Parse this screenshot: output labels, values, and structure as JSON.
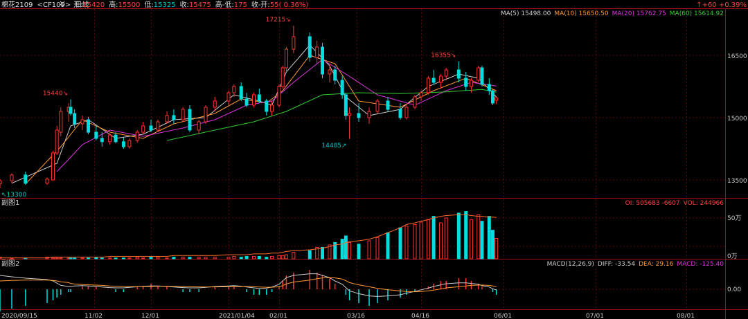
{
  "header": {
    "symbol": "棉花2109",
    "code": "<CF109>",
    "period": "日线",
    "period_icon": "double-chevron-down-icon",
    "items": [
      {
        "label": "开:",
        "value": "15420",
        "color": "#ff4040"
      },
      {
        "label": "高:",
        "value": "15500",
        "color": "#ff4040"
      },
      {
        "label": "低:",
        "value": "15325",
        "color": "#00cccc"
      },
      {
        "label": "收:",
        "value": "15475",
        "color": "#ff4040"
      },
      {
        "label": "高-低:",
        "value": "175",
        "color": "#ff4040"
      },
      {
        "label": "收-开:",
        "value": "55( 0.36%)",
        "color": "#ff4040"
      }
    ],
    "change": "↑+60  +0.39%"
  },
  "ma_legend": [
    {
      "label": "MA(5)",
      "value": "15498.00",
      "color": "#cccccc"
    },
    {
      "label": "MA(10)",
      "value": "15650.50",
      "color": "#ff9933"
    },
    {
      "label": "MA(20)",
      "value": "15762.75",
      "color": "#dd33dd"
    },
    {
      "label": "MA(60)",
      "value": "15614.92",
      "color": "#33cc33"
    }
  ],
  "sub1": {
    "title": "副图1",
    "legend": [
      {
        "label": "OI:",
        "value": "505683 -6607",
        "color": "#ff4040"
      },
      {
        "label": "VOL:",
        "value": "244966",
        "color": "#ff4040"
      }
    ],
    "axis": [
      "50万",
      "0万"
    ]
  },
  "sub2": {
    "title": "副图2",
    "legend": [
      {
        "label": "MACD(12,26,9)",
        "value": "",
        "color": "#cccccc"
      },
      {
        "label": "DIFF:",
        "value": "-33.54",
        "color": "#cccccc"
      },
      {
        "label": "DEA:",
        "value": "29.16",
        "color": "#ff9933"
      },
      {
        "label": "MACD:",
        "value": "-125.40",
        "color": "#dd33dd"
      }
    ],
    "axis": [
      "0.00"
    ]
  },
  "annotations": [
    {
      "text": "17215↘",
      "date": "2021-02-09",
      "price": 17215,
      "color": "#ff4040"
    },
    {
      "text": "15440↘",
      "date": "2020-10-21",
      "price": 15440,
      "color": "#ff4040"
    },
    {
      "text": "16355↘",
      "date": "2021-05-07",
      "price": 16355,
      "color": "#ff4040"
    },
    {
      "text": "14485↗",
      "date": "2021-03-12",
      "price": 14485,
      "color": "#00cccc"
    },
    {
      "text": "↖13300",
      "date": "2020-09-15",
      "price": 13300,
      "color": "#00cccc"
    }
  ],
  "chart_data": {
    "type": "candlestick",
    "price_ticks": [
      13500,
      15000,
      16500
    ],
    "price_range": [
      13250,
      17450
    ],
    "x_tick_labels": [
      "2020/09/15",
      "11/02",
      "12/01",
      "2021/01/04",
      "02/01",
      "03/16",
      "04/16",
      "06/01",
      "07/01",
      "08/01"
    ],
    "candles": [
      {
        "d": "2020-09-15",
        "o": 13410,
        "h": 13520,
        "l": 13300,
        "c": 13480
      },
      {
        "d": "2020-09-21",
        "o": 13480,
        "h": 13660,
        "l": 13420,
        "c": 13620
      },
      {
        "d": "2020-09-28",
        "o": 13620,
        "h": 13700,
        "l": 13380,
        "c": 13420
      },
      {
        "d": "2020-10-09",
        "o": 13420,
        "h": 13560,
        "l": 13380,
        "c": 13520
      },
      {
        "d": "2020-10-12",
        "o": 13500,
        "h": 14200,
        "l": 13480,
        "c": 14150
      },
      {
        "d": "2020-10-14",
        "o": 14150,
        "h": 14800,
        "l": 14100,
        "c": 14700
      },
      {
        "d": "2020-10-16",
        "o": 14650,
        "h": 15250,
        "l": 14550,
        "c": 15150
      },
      {
        "d": "2020-10-20",
        "o": 15150,
        "h": 15350,
        "l": 14900,
        "c": 15250
      },
      {
        "d": "2020-10-21",
        "o": 15250,
        "h": 15440,
        "l": 15050,
        "c": 15100
      },
      {
        "d": "2020-10-23",
        "o": 15100,
        "h": 15200,
        "l": 14750,
        "c": 14850
      },
      {
        "d": "2020-10-27",
        "o": 14850,
        "h": 15050,
        "l": 14700,
        "c": 14950
      },
      {
        "d": "2020-10-30",
        "o": 14950,
        "h": 15020,
        "l": 14600,
        "c": 14650
      },
      {
        "d": "2020-11-03",
        "o": 14650,
        "h": 14800,
        "l": 14450,
        "c": 14500
      },
      {
        "d": "2020-11-06",
        "o": 14500,
        "h": 14650,
        "l": 14300,
        "c": 14420
      },
      {
        "d": "2020-11-10",
        "o": 14420,
        "h": 14620,
        "l": 14350,
        "c": 14580
      },
      {
        "d": "2020-11-13",
        "o": 14580,
        "h": 14650,
        "l": 14380,
        "c": 14420
      },
      {
        "d": "2020-11-17",
        "o": 14420,
        "h": 14520,
        "l": 14250,
        "c": 14300
      },
      {
        "d": "2020-11-20",
        "o": 14300,
        "h": 14500,
        "l": 14250,
        "c": 14450
      },
      {
        "d": "2020-11-24",
        "o": 14450,
        "h": 14700,
        "l": 14400,
        "c": 14650
      },
      {
        "d": "2020-11-27",
        "o": 14650,
        "h": 14900,
        "l": 14600,
        "c": 14800
      },
      {
        "d": "2020-12-01",
        "o": 14800,
        "h": 14950,
        "l": 14650,
        "c": 14700
      },
      {
        "d": "2020-12-04",
        "o": 14700,
        "h": 14950,
        "l": 14650,
        "c": 14900
      },
      {
        "d": "2020-12-08",
        "o": 14900,
        "h": 15150,
        "l": 14850,
        "c": 15050
      },
      {
        "d": "2020-12-11",
        "o": 15050,
        "h": 15200,
        "l": 14850,
        "c": 14950
      },
      {
        "d": "2020-12-15",
        "o": 14950,
        "h": 15250,
        "l": 14900,
        "c": 15200
      },
      {
        "d": "2020-12-18",
        "o": 15200,
        "h": 15300,
        "l": 14650,
        "c": 14700
      },
      {
        "d": "2020-12-22",
        "o": 14700,
        "h": 14950,
        "l": 14600,
        "c": 14900
      },
      {
        "d": "2020-12-25",
        "o": 14900,
        "h": 15300,
        "l": 14850,
        "c": 15250
      },
      {
        "d": "2020-12-29",
        "o": 15250,
        "h": 15500,
        "l": 15150,
        "c": 15400
      },
      {
        "d": "2021-01-04",
        "o": 15400,
        "h": 15650,
        "l": 15300,
        "c": 15600
      },
      {
        "d": "2021-01-07",
        "o": 15600,
        "h": 15800,
        "l": 15500,
        "c": 15750
      },
      {
        "d": "2021-01-11",
        "o": 15750,
        "h": 15850,
        "l": 15400,
        "c": 15450
      },
      {
        "d": "2021-01-14",
        "o": 15450,
        "h": 15600,
        "l": 15250,
        "c": 15300
      },
      {
        "d": "2021-01-18",
        "o": 15300,
        "h": 15600,
        "l": 15250,
        "c": 15550
      },
      {
        "d": "2021-01-21",
        "o": 15550,
        "h": 15700,
        "l": 15350,
        "c": 15400
      },
      {
        "d": "2021-01-25",
        "o": 15400,
        "h": 15450,
        "l": 15050,
        "c": 15150
      },
      {
        "d": "2021-01-28",
        "o": 15150,
        "h": 15400,
        "l": 15050,
        "c": 15300
      },
      {
        "d": "2021-02-01",
        "o": 15300,
        "h": 15800,
        "l": 15250,
        "c": 15750
      },
      {
        "d": "2021-02-03",
        "o": 15750,
        "h": 16250,
        "l": 15700,
        "c": 16200
      },
      {
        "d": "2021-02-05",
        "o": 16200,
        "h": 16700,
        "l": 16100,
        "c": 16650
      },
      {
        "d": "2021-02-09",
        "o": 16650,
        "h": 17215,
        "l": 16550,
        "c": 16950
      },
      {
        "d": "2021-02-18",
        "o": 16950,
        "h": 17050,
        "l": 16350,
        "c": 16450
      },
      {
        "d": "2021-02-22",
        "o": 16450,
        "h": 16850,
        "l": 16300,
        "c": 16700
      },
      {
        "d": "2021-02-25",
        "o": 16700,
        "h": 16800,
        "l": 15950,
        "c": 16050
      },
      {
        "d": "2021-03-01",
        "o": 16050,
        "h": 16300,
        "l": 15850,
        "c": 16150
      },
      {
        "d": "2021-03-04",
        "o": 16150,
        "h": 16250,
        "l": 15800,
        "c": 15900
      },
      {
        "d": "2021-03-08",
        "o": 15900,
        "h": 16000,
        "l": 15450,
        "c": 15550
      },
      {
        "d": "2021-03-10",
        "o": 15550,
        "h": 15600,
        "l": 14950,
        "c": 15050
      },
      {
        "d": "2021-03-12",
        "o": 15050,
        "h": 15250,
        "l": 14485,
        "c": 15100
      },
      {
        "d": "2021-03-17",
        "o": 15100,
        "h": 15350,
        "l": 14900,
        "c": 15000
      },
      {
        "d": "2021-03-22",
        "o": 15000,
        "h": 15250,
        "l": 14850,
        "c": 15150
      },
      {
        "d": "2021-03-26",
        "o": 15150,
        "h": 15450,
        "l": 15100,
        "c": 15400
      },
      {
        "d": "2021-03-31",
        "o": 15400,
        "h": 15500,
        "l": 15150,
        "c": 15200
      },
      {
        "d": "2021-04-06",
        "o": 15200,
        "h": 15350,
        "l": 14950,
        "c": 15000
      },
      {
        "d": "2021-04-09",
        "o": 15000,
        "h": 15300,
        "l": 14950,
        "c": 15250
      },
      {
        "d": "2021-04-13",
        "o": 15250,
        "h": 15550,
        "l": 15200,
        "c": 15500
      },
      {
        "d": "2021-04-16",
        "o": 15500,
        "h": 15650,
        "l": 15400,
        "c": 15600
      },
      {
        "d": "2021-04-20",
        "o": 15600,
        "h": 16000,
        "l": 15550,
        "c": 15950
      },
      {
        "d": "2021-04-23",
        "o": 15950,
        "h": 16150,
        "l": 15800,
        "c": 15850
      },
      {
        "d": "2021-04-27",
        "o": 15850,
        "h": 16050,
        "l": 15700,
        "c": 16000
      },
      {
        "d": "2021-04-30",
        "o": 16000,
        "h": 16200,
        "l": 15900,
        "c": 16150
      },
      {
        "d": "2021-05-07",
        "o": 16150,
        "h": 16355,
        "l": 15850,
        "c": 15950
      },
      {
        "d": "2021-05-11",
        "o": 15950,
        "h": 16100,
        "l": 15650,
        "c": 15750
      },
      {
        "d": "2021-05-14",
        "o": 15750,
        "h": 15950,
        "l": 15600,
        "c": 15900
      },
      {
        "d": "2021-05-18",
        "o": 15900,
        "h": 16250,
        "l": 15850,
        "c": 16200
      },
      {
        "d": "2021-05-20",
        "o": 16200,
        "h": 16250,
        "l": 15750,
        "c": 15800
      },
      {
        "d": "2021-05-24",
        "o": 15800,
        "h": 15950,
        "l": 15550,
        "c": 15650
      },
      {
        "d": "2021-05-26",
        "o": 15650,
        "h": 15700,
        "l": 15300,
        "c": 15350
      },
      {
        "d": "2021-05-28",
        "o": 15420,
        "h": 15500,
        "l": 15325,
        "c": 15475
      }
    ],
    "ma_lines": [
      {
        "name": "MA(5)",
        "color": "#cccccc",
        "points": [
          [
            "2020-09-21",
            13420
          ],
          [
            "2020-10-14",
            13900
          ],
          [
            "2020-10-21",
            14800
          ],
          [
            "2020-10-30",
            14950
          ],
          [
            "2020-11-13",
            14500
          ],
          [
            "2020-11-27",
            14600
          ],
          [
            "2020-12-11",
            14950
          ],
          [
            "2020-12-25",
            15000
          ],
          [
            "2021-01-07",
            15550
          ],
          [
            "2021-01-21",
            15400
          ],
          [
            "2021-01-28",
            15300
          ],
          [
            "2021-02-05",
            16100
          ],
          [
            "2021-02-18",
            16750
          ],
          [
            "2021-03-01",
            16250
          ],
          [
            "2021-03-10",
            15500
          ],
          [
            "2021-03-22",
            15050
          ],
          [
            "2021-04-06",
            15200
          ],
          [
            "2021-04-20",
            15750
          ],
          [
            "2021-05-07",
            16050
          ],
          [
            "2021-05-18",
            15950
          ],
          [
            "2021-05-28",
            15500
          ]
        ]
      },
      {
        "name": "MA(10)",
        "color": "#ff9933",
        "points": [
          [
            "2020-09-28",
            13400
          ],
          [
            "2020-10-16",
            14300
          ],
          [
            "2020-10-27",
            14950
          ],
          [
            "2020-11-10",
            14650
          ],
          [
            "2020-11-27",
            14500
          ],
          [
            "2020-12-11",
            14850
          ],
          [
            "2020-12-29",
            15100
          ],
          [
            "2021-01-11",
            15450
          ],
          [
            "2021-01-25",
            15350
          ],
          [
            "2021-02-03",
            15650
          ],
          [
            "2021-02-18",
            16500
          ],
          [
            "2021-03-04",
            16300
          ],
          [
            "2021-03-17",
            15400
          ],
          [
            "2021-04-06",
            15250
          ],
          [
            "2021-04-23",
            15650
          ],
          [
            "2021-05-11",
            15950
          ],
          [
            "2021-05-28",
            15650
          ]
        ]
      },
      {
        "name": "MA(20)",
        "color": "#dd33dd",
        "points": [
          [
            "2020-10-14",
            13700
          ],
          [
            "2020-10-27",
            14350
          ],
          [
            "2020-11-10",
            14700
          ],
          [
            "2020-11-27",
            14550
          ],
          [
            "2020-12-15",
            14750
          ],
          [
            "2020-12-29",
            14950
          ],
          [
            "2021-01-14",
            15300
          ],
          [
            "2021-01-28",
            15400
          ],
          [
            "2021-02-09",
            15850
          ],
          [
            "2021-02-25",
            16400
          ],
          [
            "2021-03-10",
            16050
          ],
          [
            "2021-03-26",
            15550
          ],
          [
            "2021-04-13",
            15300
          ],
          [
            "2021-04-30",
            15650
          ],
          [
            "2021-05-14",
            15850
          ],
          [
            "2021-05-28",
            15763
          ]
        ]
      },
      {
        "name": "MA(60)",
        "color": "#33cc33",
        "points": [
          [
            "2020-12-08",
            14450
          ],
          [
            "2020-12-29",
            14700
          ],
          [
            "2021-01-18",
            14900
          ],
          [
            "2021-02-05",
            15150
          ],
          [
            "2021-02-25",
            15550
          ],
          [
            "2021-03-17",
            15600
          ],
          [
            "2021-04-06",
            15580
          ],
          [
            "2021-04-30",
            15620
          ],
          [
            "2021-05-20",
            15680
          ],
          [
            "2021-05-28",
            15615
          ]
        ]
      }
    ],
    "volume_wan": [
      2,
      1,
      1,
      2,
      1,
      1,
      1,
      1,
      1,
      1,
      1,
      1,
      2,
      1,
      1,
      1,
      1,
      1,
      2,
      1,
      2,
      2,
      1,
      2,
      2,
      2,
      2,
      2,
      2,
      2,
      3,
      2,
      3,
      3,
      3,
      2,
      3,
      4,
      4,
      5,
      8,
      10,
      14,
      14,
      17,
      20,
      24,
      28,
      20,
      18,
      22,
      26,
      32,
      38,
      40,
      42,
      45,
      48,
      52,
      44,
      50,
      56,
      58,
      48,
      54,
      46,
      52,
      35,
      25
    ],
    "open_interest_wan": [
      1,
      1,
      1,
      1,
      2,
      2,
      2,
      2,
      2,
      2,
      2,
      2,
      2,
      2,
      3,
      3,
      3,
      3,
      3,
      3,
      3,
      3,
      3,
      4,
      4,
      4,
      4,
      4,
      4,
      5,
      5,
      5,
      5,
      6,
      6,
      6,
      7,
      7,
      8,
      9,
      10,
      11,
      12,
      13,
      15,
      17,
      18,
      20,
      21,
      22,
      24,
      27,
      32,
      38,
      42,
      44,
      46,
      48,
      50,
      52,
      53,
      54,
      54,
      53,
      52,
      52,
      51,
      51,
      50.6
    ],
    "macd_hist": [
      -8,
      -7,
      -6,
      -5,
      -4,
      -3,
      -2,
      -1,
      -1,
      0,
      1,
      1,
      1,
      0,
      0,
      -1,
      -1,
      0,
      1,
      1,
      2,
      1,
      1,
      0,
      -1,
      -1,
      -1,
      0,
      1,
      1,
      1,
      0,
      -1,
      -2,
      -2,
      -2,
      -1,
      1,
      3,
      5,
      6,
      7,
      6,
      5,
      4,
      2,
      0,
      -2,
      -4,
      -5,
      -6,
      -5,
      -4,
      -3,
      -2,
      -1,
      0,
      1,
      2,
      3,
      3,
      4,
      4,
      3,
      2,
      1,
      0,
      -1,
      -2
    ],
    "macd_diff": [
      5,
      4.5,
      4,
      3.5,
      3,
      2.2,
      1.4,
      1,
      1,
      1.2,
      1.3,
      1.2,
      1,
      0.8,
      0.6,
      0.5,
      0.5,
      0.7,
      0.9,
      1.1,
      1.2,
      1.2,
      1,
      0.8,
      0.6,
      0.5,
      0.5,
      0.7,
      1,
      1.2,
      1.3,
      1.1,
      0.8,
      0.5,
      0.3,
      0.4,
      0.8,
      1.8,
      3,
      4.2,
      5,
      5.6,
      5.6,
      5,
      4.2,
      3,
      1.8,
      0.6,
      -0.6,
      -1.6,
      -2.4,
      -2.6,
      -2.4,
      -2,
      -1.4,
      -0.8,
      -0.2,
      0.4,
      1,
      1.6,
      2,
      2.3,
      2.3,
      2.1,
      1.8,
      1.3,
      0.8,
      0.2,
      -0.3
    ],
    "macd_dea": [
      3,
      3.2,
      3.3,
      3.3,
      3.2,
      3,
      2.7,
      2.4,
      2.1,
      1.9,
      1.7,
      1.6,
      1.5,
      1.4,
      1.2,
      1.1,
      1,
      0.95,
      0.95,
      1,
      1,
      1.05,
      1.05,
      1,
      0.95,
      0.9,
      0.85,
      0.82,
      0.85,
      0.9,
      0.95,
      1,
      0.98,
      0.9,
      0.8,
      0.72,
      0.72,
      0.9,
      1.3,
      1.9,
      2.6,
      3.3,
      3.8,
      4.1,
      4.2,
      4.1,
      3.7,
      3.1,
      2.4,
      1.6,
      0.9,
      0.3,
      -0.2,
      -0.6,
      -0.8,
      -0.9,
      -0.8,
      -0.6,
      -0.3,
      0.1,
      0.5,
      0.9,
      1.2,
      1.4,
      1.5,
      1.5,
      1.4,
      1.2,
      0.9
    ]
  }
}
